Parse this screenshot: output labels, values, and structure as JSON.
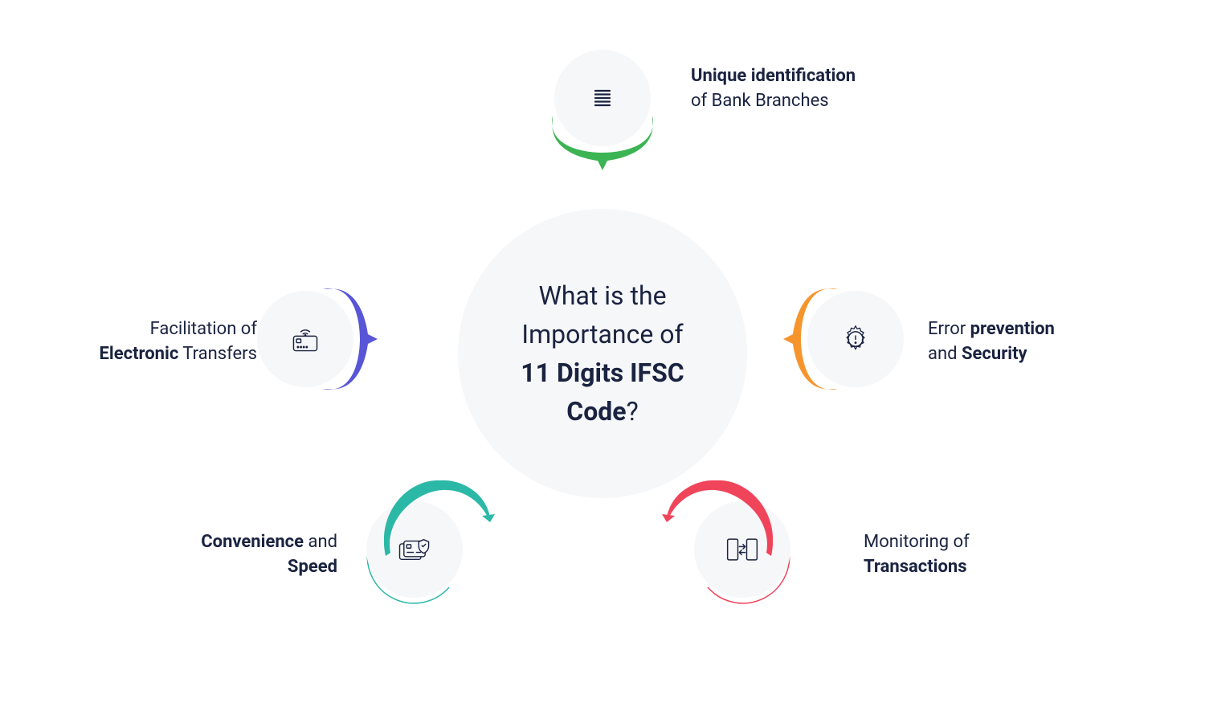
{
  "center": {
    "line1": "What is the",
    "line2": "Importance of",
    "bold": "11 Digits IFSC Code",
    "q": "?"
  },
  "nodes": {
    "top": {
      "label_bold": "Unique identification",
      "label_rest": "of Bank Branches",
      "color": "#3cb454",
      "icon": "list"
    },
    "right": {
      "label_pre": "Error ",
      "label_bold1": "prevention",
      "label_mid": "and ",
      "label_bold2": "Security",
      "color": "#f5952c",
      "icon": "gear-alert"
    },
    "bottomright": {
      "label_pre": "Monitoring of",
      "label_bold": "Transactions",
      "color": "#f0445a",
      "icon": "transfer"
    },
    "bottomleft": {
      "label_bold1": "Convenience",
      "label_mid": " and",
      "label_bold2": "Speed",
      "color": "#2cb8a6",
      "icon": "card-shield"
    },
    "left": {
      "label_pre": "Facilitation of",
      "label_bold": "Electronic",
      "label_post": " Transfers",
      "color": "#5856d6",
      "icon": "card-wifi"
    }
  }
}
